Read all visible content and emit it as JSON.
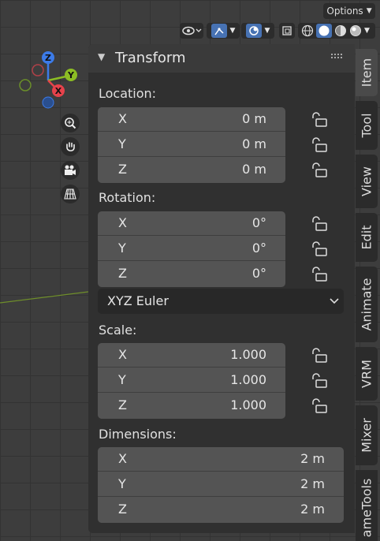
{
  "header": {
    "options_label": "Options"
  },
  "gizmo": {
    "z_label": "Z",
    "y_label": "Y",
    "x_label": "X",
    "colors": {
      "x": "#e6424b",
      "y": "#8cbd24",
      "z": "#3c7be8"
    }
  },
  "panel": {
    "title": "Transform",
    "location": {
      "label": "Location:",
      "rows": [
        {
          "axis": "X",
          "value": "0 m"
        },
        {
          "axis": "Y",
          "value": "0 m"
        },
        {
          "axis": "Z",
          "value": "0 m"
        }
      ]
    },
    "rotation": {
      "label": "Rotation:",
      "rows": [
        {
          "axis": "X",
          "value": "0°"
        },
        {
          "axis": "Y",
          "value": "0°"
        },
        {
          "axis": "Z",
          "value": "0°"
        }
      ],
      "mode": "XYZ Euler"
    },
    "scale": {
      "label": "Scale:",
      "rows": [
        {
          "axis": "X",
          "value": "1.000"
        },
        {
          "axis": "Y",
          "value": "1.000"
        },
        {
          "axis": "Z",
          "value": "1.000"
        }
      ]
    },
    "dimensions": {
      "label": "Dimensions:",
      "rows": [
        {
          "axis": "X",
          "value": "2 m"
        },
        {
          "axis": "Y",
          "value": "2 m"
        },
        {
          "axis": "Z",
          "value": "2 m"
        }
      ]
    }
  },
  "tabs": [
    {
      "label": "Item"
    },
    {
      "label": "Tool"
    },
    {
      "label": "View"
    },
    {
      "label": "Edit"
    },
    {
      "label": "Animate"
    },
    {
      "label": "VRM"
    },
    {
      "label": "Mixer"
    },
    {
      "label": "ameTools"
    }
  ]
}
